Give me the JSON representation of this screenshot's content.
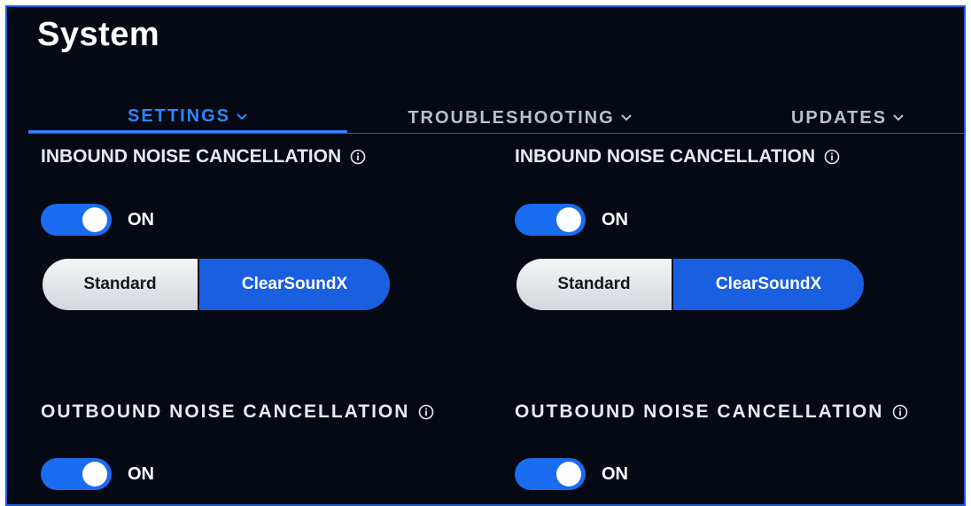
{
  "page": {
    "title": "System"
  },
  "tabs": [
    {
      "label": "SETTINGS",
      "active": true
    },
    {
      "label": "TROUBLESHOOTING",
      "active": false
    },
    {
      "label": "UPDATES",
      "active": false
    }
  ],
  "columns": [
    {
      "inbound": {
        "label": "INBOUND NOISE CANCELLATION",
        "toggle_state": "ON",
        "options": [
          "Standard",
          "ClearSoundX"
        ],
        "selected": "ClearSoundX"
      },
      "outbound": {
        "label": "OUTBOUND NOISE CANCELLATION",
        "toggle_state": "ON"
      }
    },
    {
      "inbound": {
        "label": "INBOUND NOISE CANCELLATION",
        "toggle_state": "ON",
        "options": [
          "Standard",
          "ClearSoundX"
        ],
        "selected": "ClearSoundX"
      },
      "outbound": {
        "label": "OUTBOUND NOISE CANCELLATION",
        "toggle_state": "ON"
      }
    }
  ],
  "icons": {
    "tab_chevron": "chevron-down-icon",
    "info": "info-icon"
  },
  "colors": {
    "background": "#050914",
    "frame_border": "#1f5bd6",
    "accent": "#2e86ff",
    "toggle_on": "#1a6cf0",
    "selected_segment": "#1a5fe0"
  }
}
